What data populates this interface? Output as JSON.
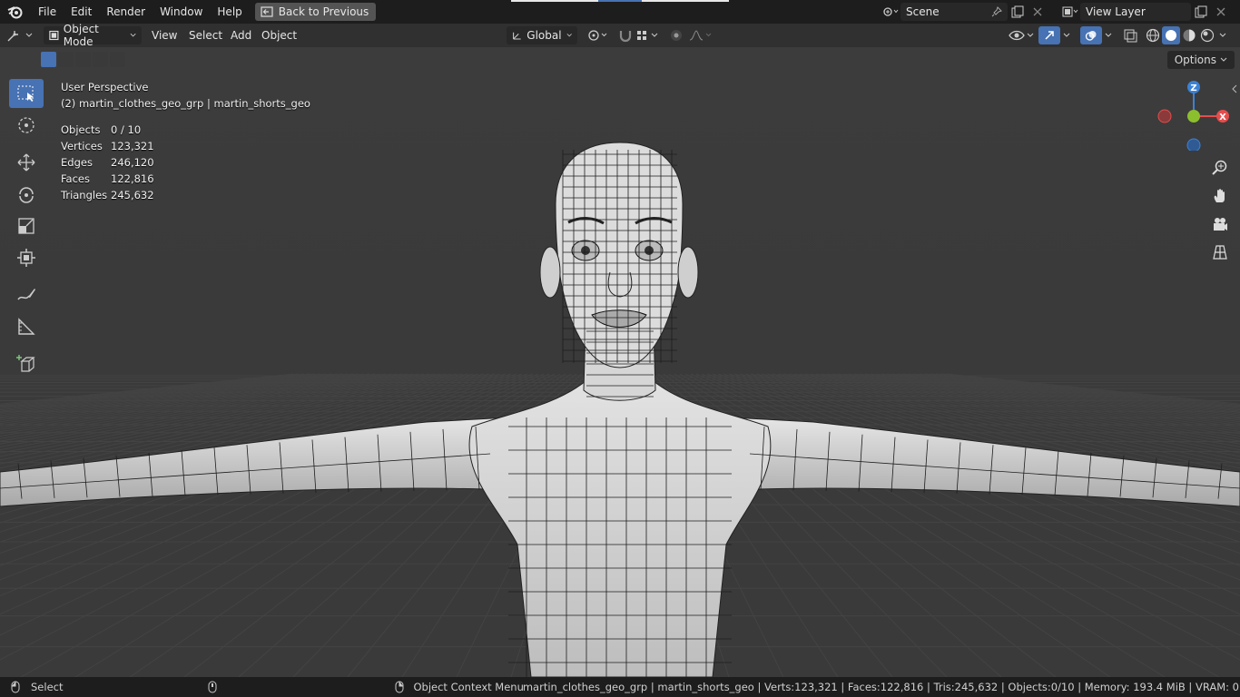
{
  "topbar": {
    "menus": [
      "File",
      "Edit",
      "Render",
      "Window",
      "Help"
    ],
    "back_label": "Back to Previous",
    "scene": "Scene",
    "view_layer": "View Layer"
  },
  "header": {
    "mode": "Object Mode",
    "menus": [
      "View",
      "Select",
      "Add",
      "Object"
    ],
    "orientation": "Global",
    "options": "Options"
  },
  "overlay": {
    "perspective": "User Perspective",
    "object_path": "(2) martin_clothes_geo_grp | martin_shorts_geo",
    "stats": [
      {
        "label": "Objects",
        "value": "0 / 10"
      },
      {
        "label": "Vertices",
        "value": "123,321"
      },
      {
        "label": "Edges",
        "value": "246,120"
      },
      {
        "label": "Faces",
        "value": "122,816"
      },
      {
        "label": "Triangles",
        "value": "245,632"
      }
    ]
  },
  "gizmo": {
    "z": "Z",
    "x": "X",
    "colors": {
      "x": "#e54d4d",
      "y": "#8cbf2e",
      "z": "#3b82d6"
    }
  },
  "statusbar": {
    "left": "Select",
    "middle": "Object Context Menu",
    "right": "martin_clothes_geo_grp | martin_shorts_geo | Verts:123,321 | Faces:122,816 | Tris:245,632 | Objects:0/10 | Memory: 193.4 MiB | VRAM: 0"
  },
  "colors": {
    "accent": "#4772b3",
    "bg": "#3d3d3d",
    "bar": "#1d1d1d"
  }
}
